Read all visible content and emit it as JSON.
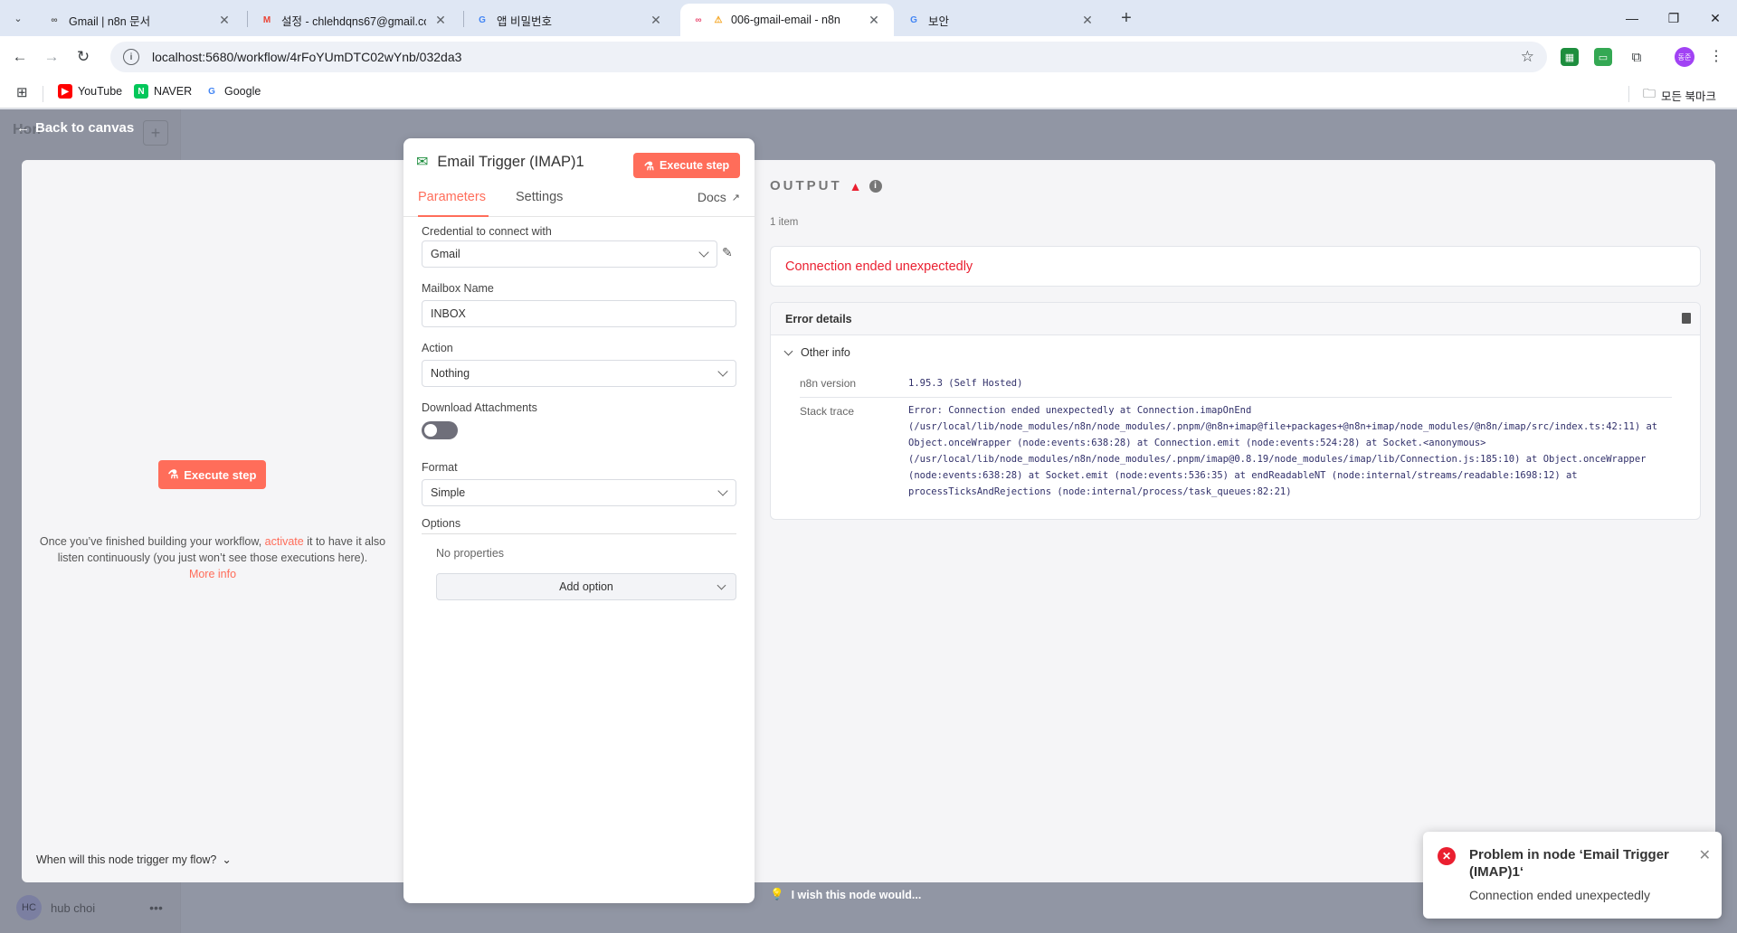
{
  "browser": {
    "tabs": [
      {
        "title": "Gmail | n8n 문서",
        "favicon": "n8n-icon"
      },
      {
        "title": "설정 - chlehdqns67@gmail.com",
        "favicon": "gmail-icon"
      },
      {
        "title": "앱 비밀번호",
        "favicon": "google-icon"
      },
      {
        "title": "006-gmail-email - n8n",
        "favicon": "n8n-icon",
        "warning": "⚠",
        "active": true
      },
      {
        "title": "보안",
        "favicon": "google-icon"
      }
    ],
    "url": "localhost:5680/workflow/4rFoYUmDTC02wYnb/032da3",
    "bookmarks": [
      {
        "label": "YouTube",
        "icon": "youtube-icon",
        "color": "#ff0000"
      },
      {
        "label": "NAVER",
        "icon": "naver-icon",
        "color": "#03c75a"
      },
      {
        "label": "Google",
        "icon": "google-icon",
        "color": "#4285f4"
      }
    ],
    "all_bookmarks_label": "모든 북마크",
    "profile_initials": "동준"
  },
  "app": {
    "back_label": "Back to canvas",
    "workflow_name_bg": "Hon",
    "user_name": "hub choi",
    "user_initials": "HC"
  },
  "input_pane": {
    "execute_label": "Execute step",
    "hint_before": "Once you’ve finished building your workflow,",
    "hint_link": "activate",
    "hint_after": "it to have it also listen continuously (you just won’t see those executions here).",
    "more_info": "More info",
    "trigger_question": "When will this node trigger my flow?"
  },
  "node": {
    "title": "Email Trigger (IMAP)1",
    "execute_label": "Execute step",
    "tabs": {
      "parameters": "Parameters",
      "settings": "Settings",
      "docs": "Docs"
    },
    "fields": {
      "credential_label": "Credential to connect with",
      "credential_value": "Gmail",
      "mailbox_label": "Mailbox Name",
      "mailbox_value": "INBOX",
      "action_label": "Action",
      "action_value": "Nothing",
      "download_label": "Download Attachments",
      "download_enabled": false,
      "format_label": "Format",
      "format_value": "Simple",
      "options_label": "Options",
      "no_properties": "No properties",
      "add_option": "Add option"
    }
  },
  "output": {
    "heading": "OUTPUT",
    "items": "1 item",
    "error_message": "Connection ended unexpectedly",
    "error_details_label": "Error details",
    "other_info_label": "Other info",
    "version_label": "n8n version",
    "version_value": "1.95.3 (Self Hosted)",
    "stack_label": "Stack trace",
    "stack_lines": [
      "Error: Connection ended unexpectedly at Connection.imapOnEnd",
      "(/usr/local/lib/node_modules/n8n/node_modules/.pnpm/@n8n+imap@file+packages+@n8n+imap/node_modules/@n8n/imap/src/index.ts:42:11) at",
      "Object.onceWrapper (node:events:638:28) at Connection.emit (node:events:524:28) at Socket.<anonymous>",
      "(/usr/local/lib/node_modules/n8n/node_modules/.pnpm/imap@0.8.19/node_modules/imap/lib/Connection.js:185:10) at Object.onceWrapper",
      "(node:events:638:28) at Socket.emit (node:events:536:35) at endReadableNT (node:internal/streams/readable:1698:12) at",
      "processTicksAndRejections (node:internal/process/task_queues:82:21)"
    ],
    "feedback": "I wish this node would..."
  },
  "toast": {
    "title": "Problem in node ‘Email Trigger (IMAP)1‘",
    "message": "Connection ended unexpectedly"
  },
  "colors": {
    "accent": "#ff6d5a",
    "error": "#ea1f30"
  }
}
